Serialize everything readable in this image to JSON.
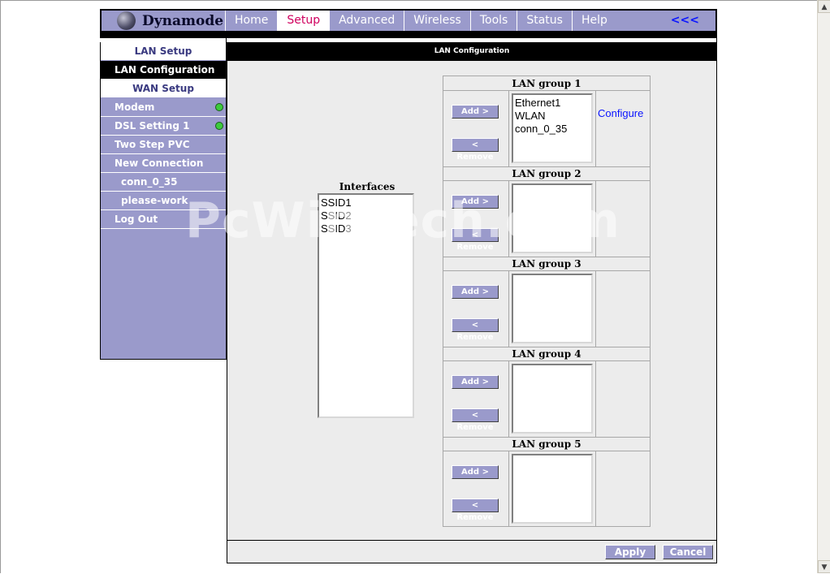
{
  "header": {
    "brand": "Dynamode",
    "tabs": [
      {
        "label": "Home",
        "active": false
      },
      {
        "label": "Setup",
        "active": true
      },
      {
        "label": "Advanced",
        "active": false
      },
      {
        "label": "Wireless",
        "active": false
      },
      {
        "label": "Tools",
        "active": false
      },
      {
        "label": "Status",
        "active": false
      },
      {
        "label": "Help",
        "active": false
      }
    ],
    "back_label": "<<<"
  },
  "sidebar": {
    "items": [
      {
        "label": "LAN Setup",
        "kind": "section"
      },
      {
        "label": "LAN Configuration",
        "kind": "active"
      },
      {
        "label": "WAN Setup",
        "kind": "section"
      },
      {
        "label": "Modem",
        "kind": "link",
        "status": "green"
      },
      {
        "label": "DSL Setting 1",
        "kind": "link",
        "status": "green"
      },
      {
        "label": "Two Step PVC",
        "kind": "link"
      },
      {
        "label": "New Connection",
        "kind": "link"
      },
      {
        "label": "conn_0_35",
        "kind": "sub"
      },
      {
        "label": "please-work",
        "kind": "sub"
      },
      {
        "label": "Log Out",
        "kind": "link"
      }
    ]
  },
  "main": {
    "title": "LAN Configuration",
    "interfaces": {
      "title": "Interfaces",
      "items": [
        "SSID1",
        "SSID2",
        "SSID3"
      ]
    },
    "groups": [
      {
        "title": "LAN group 1",
        "items": [
          "Ethernet1",
          "WLAN",
          "conn_0_35"
        ],
        "configure": "Configure"
      },
      {
        "title": "LAN group 2",
        "items": []
      },
      {
        "title": "LAN group 3",
        "items": []
      },
      {
        "title": "LAN group 4",
        "items": []
      },
      {
        "title": "LAN group 5",
        "items": []
      }
    ],
    "add_label": "Add >",
    "remove_label": "< Remove",
    "apply_label": "Apply",
    "cancel_label": "Cancel"
  },
  "watermark": "PcWinTech.com",
  "colors": {
    "nav_bar": "#9a9acb",
    "active_tab_text": "#d0005e",
    "status_dot": "#3ccc3c",
    "link": "#0a14ff"
  }
}
